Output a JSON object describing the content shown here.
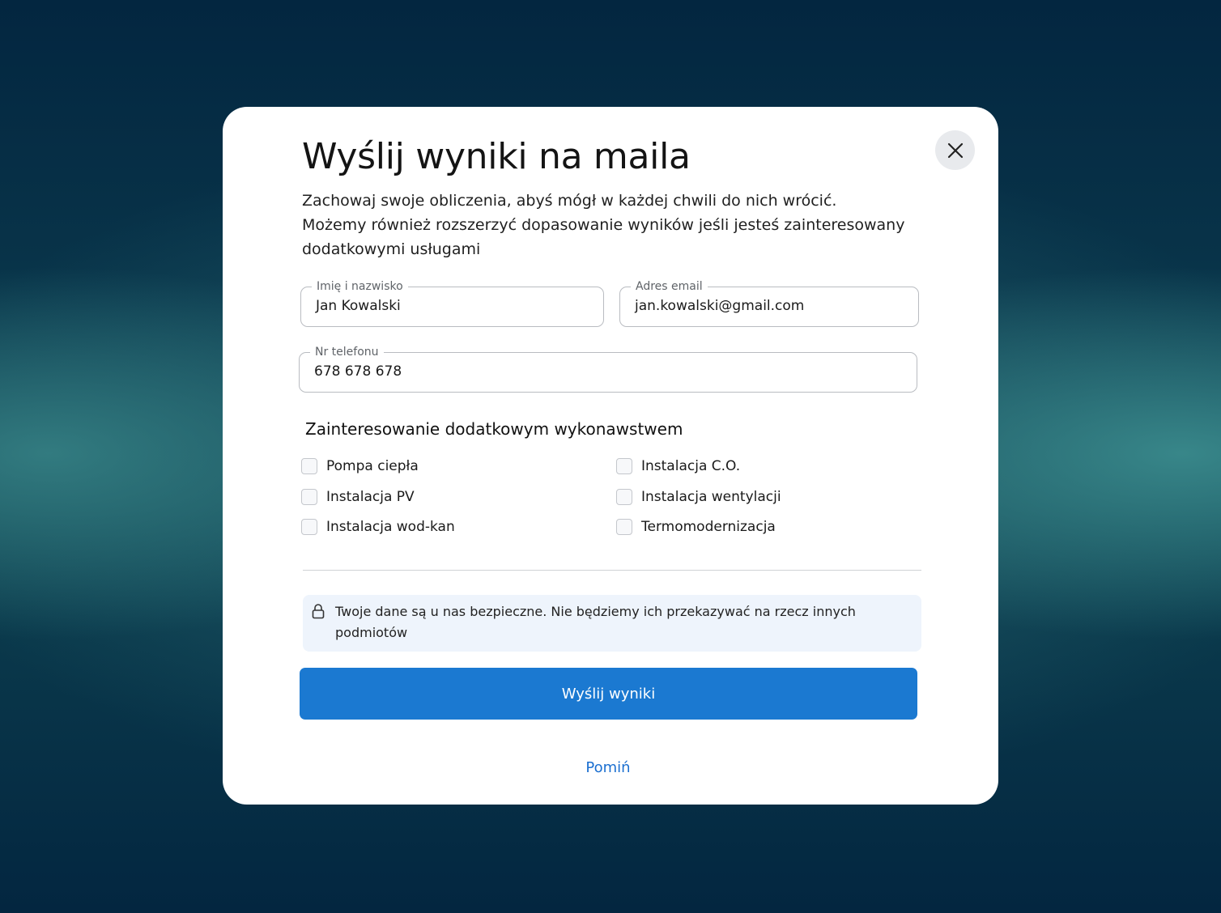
{
  "modal": {
    "title": "Wyślij wyniki na maila",
    "description_lines": [
      "Zachowaj swoje obliczenia, abyś mógł w każdej chwili do nich wrócić.",
      "Możemy również rozszerzyć dopasowanie wyników jeśli jesteś zainteresowany",
      "dodatkowymi usługami"
    ],
    "close_icon": "close-icon"
  },
  "form": {
    "name": {
      "label": "Imię i nazwisko",
      "value": "Jan Kowalski"
    },
    "email": {
      "label": "Adres email",
      "value": "jan.kowalski@gmail.com"
    },
    "phone": {
      "label": "Nr telefonu",
      "value": "678 678 678"
    }
  },
  "interests": {
    "title": "Zainteresowanie dodatkowym wykonawstwem",
    "options": [
      {
        "label": "Pompa ciepła",
        "checked": false
      },
      {
        "label": "Instalacja C.O.",
        "checked": false
      },
      {
        "label": "Instalacja PV",
        "checked": false
      },
      {
        "label": "Instalacja wentylacji",
        "checked": false
      },
      {
        "label": "Instalacja wod-kan",
        "checked": false
      },
      {
        "label": "Termomodernizacja",
        "checked": false
      }
    ]
  },
  "notice": {
    "icon": "lock-icon",
    "text_lines": [
      "Twoje dane są u nas bezpieczne. Nie będziemy ich przekazywać na rzecz innych",
      "podmiotów"
    ]
  },
  "actions": {
    "submit_label": "Wyślij wyniki",
    "skip_label": "Pomiń"
  },
  "colors": {
    "accent": "#1b79d1",
    "link": "#1b6fd0",
    "background": "#032640",
    "notice_bg": "#eef4fc"
  }
}
